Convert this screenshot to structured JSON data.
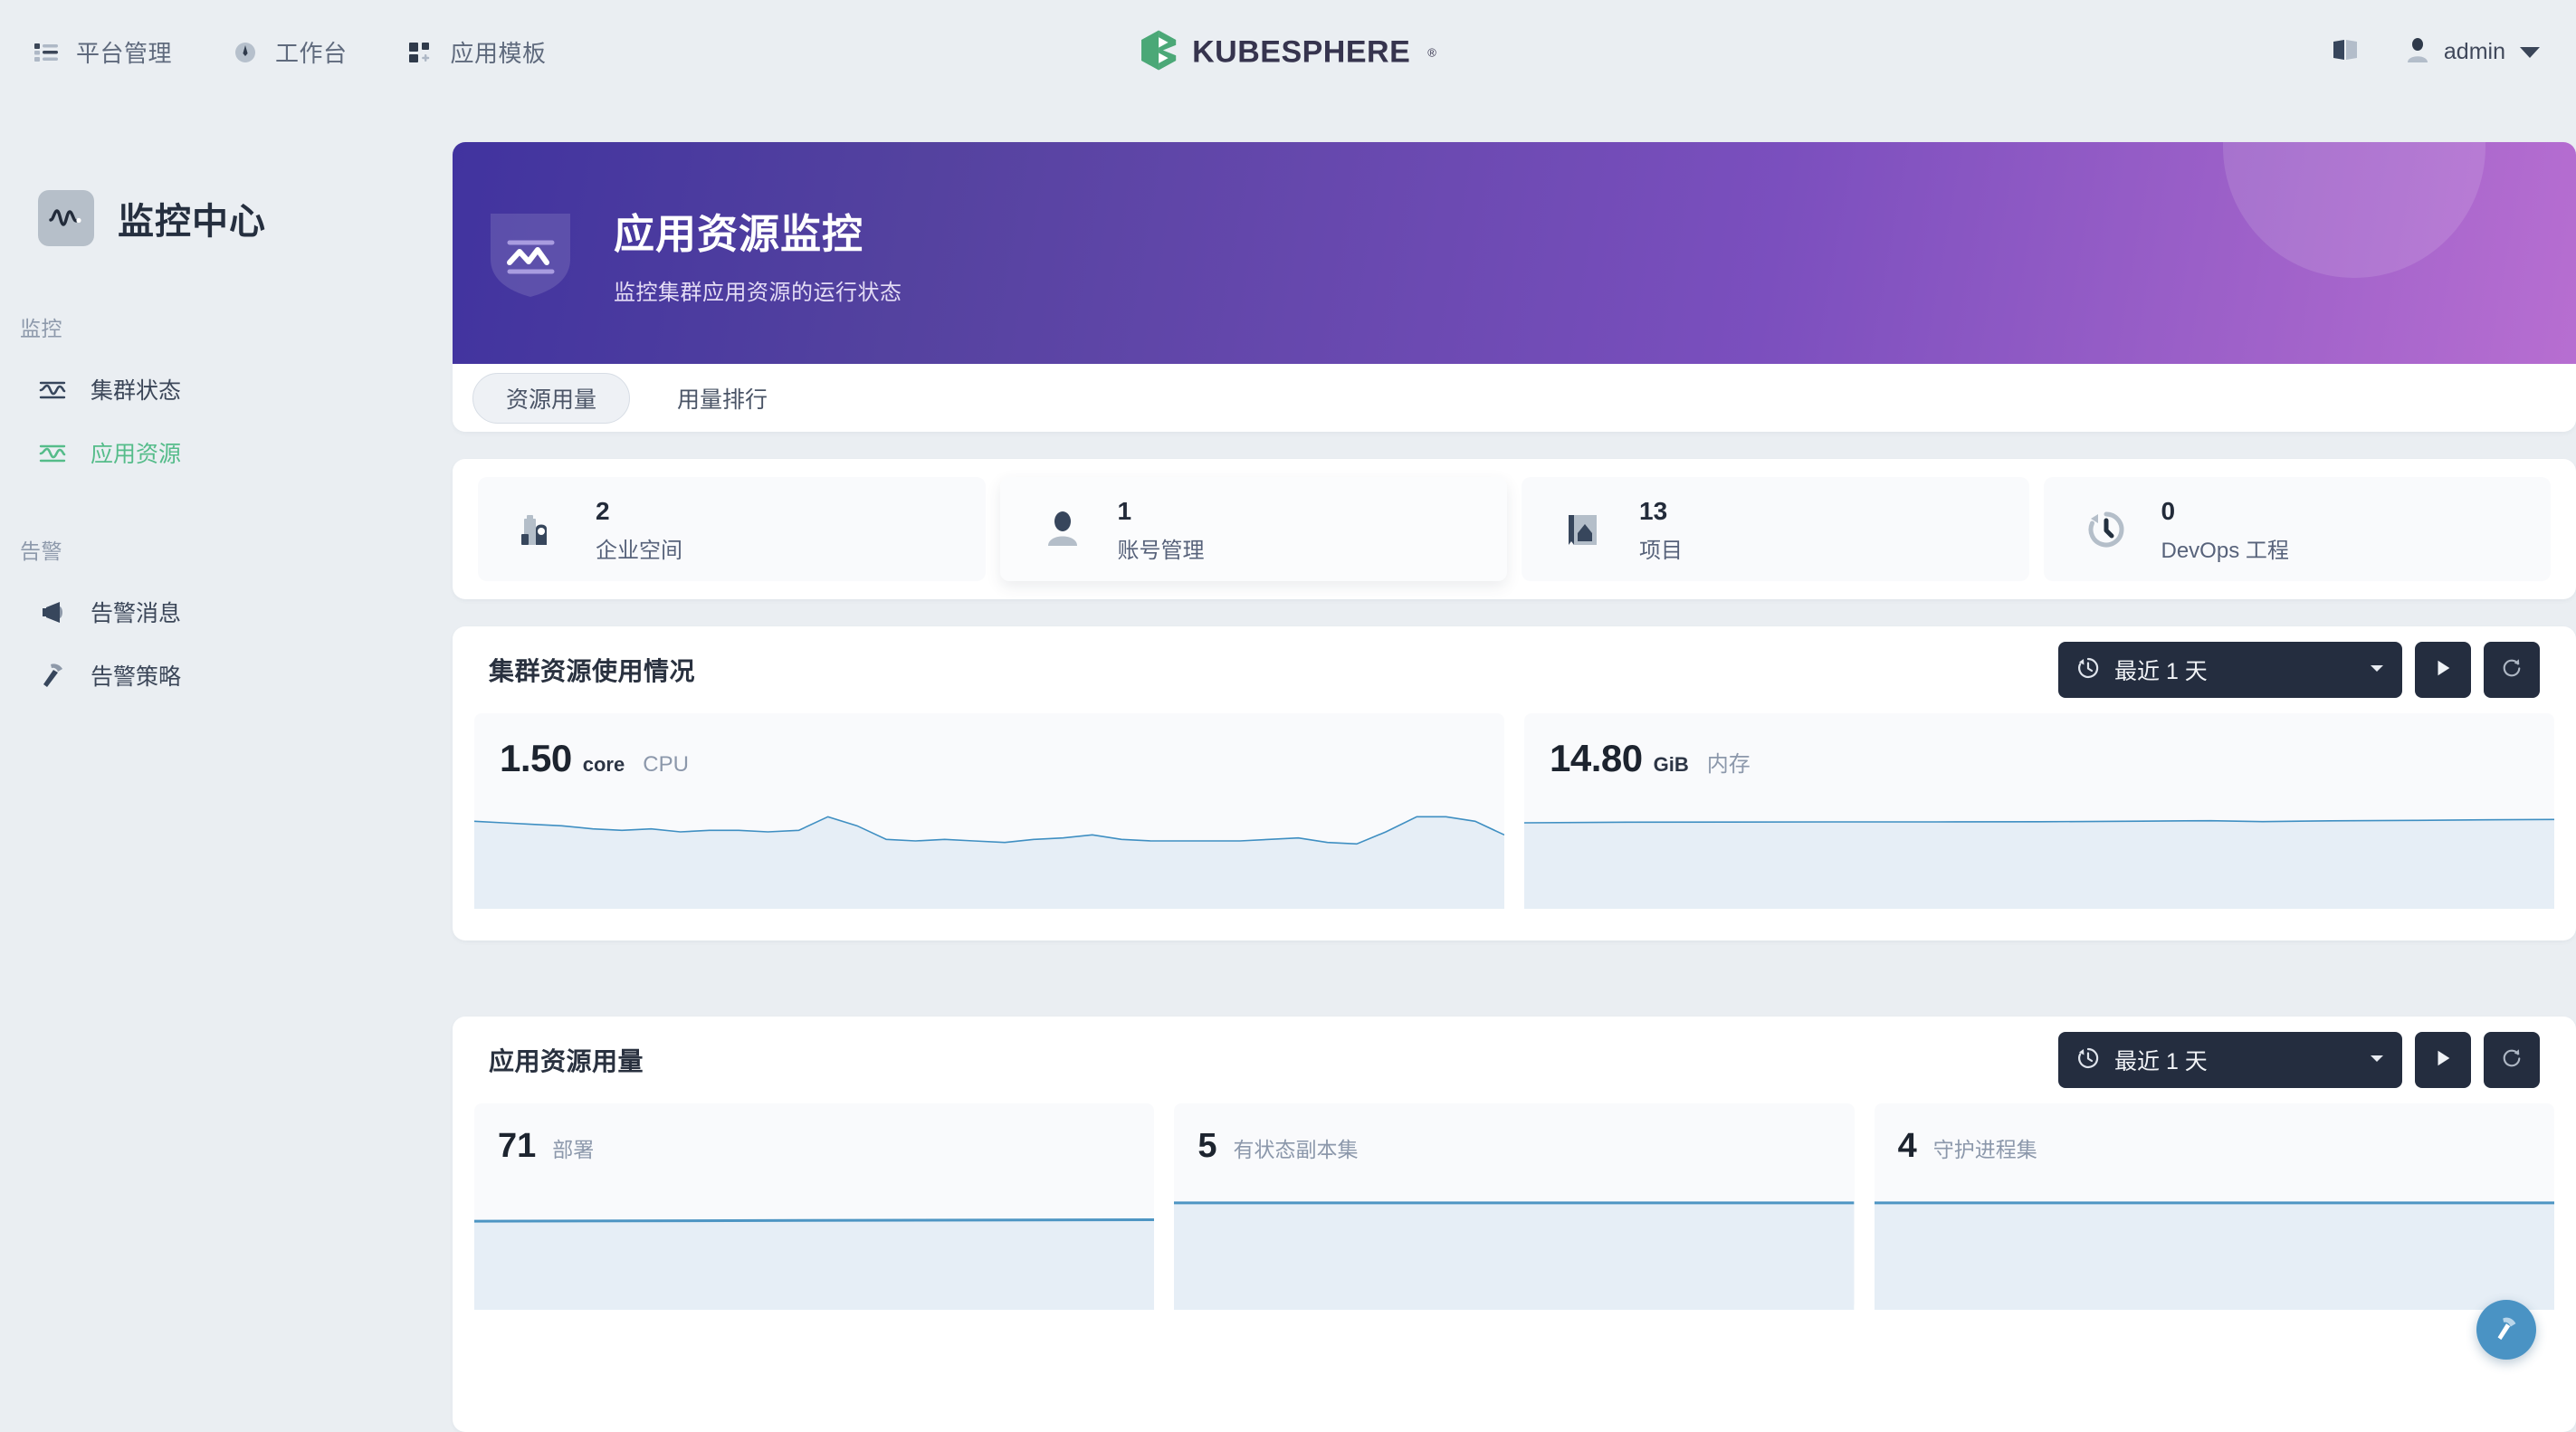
{
  "topnav": {
    "items": [
      {
        "label": "平台管理",
        "icon": "list-layout-icon"
      },
      {
        "label": "工作台",
        "icon": "compass-icon"
      },
      {
        "label": "应用模板",
        "icon": "grid-add-icon"
      }
    ],
    "brand": {
      "word": "KUBESPHERE",
      "reg": "®",
      "logo_color": "#4BA877",
      "word_color": "#36344E"
    },
    "docs_icon": "book-icon",
    "user": {
      "name": "admin",
      "avatar_icon": "user-avatar-icon",
      "caret": "chevron-down-icon"
    }
  },
  "sidebar": {
    "title": "监控中心",
    "title_icon": "monitoring-wave-icon",
    "groups": [
      {
        "label": "监控",
        "items": [
          {
            "label": "集群状态",
            "icon": "wave-icon",
            "active": false
          },
          {
            "label": "应用资源",
            "icon": "wave-icon",
            "active": true
          }
        ]
      },
      {
        "label": "告警",
        "items": [
          {
            "label": "告警消息",
            "icon": "megaphone-icon",
            "active": false
          },
          {
            "label": "告警策略",
            "icon": "hammer-icon",
            "active": false
          }
        ]
      }
    ]
  },
  "banner": {
    "title": "应用资源监控",
    "subtitle": "监控集群应用资源的运行状态",
    "icon": "shield-wave-icon",
    "gradient_from": "#41339F",
    "gradient_to": "#B76ED1"
  },
  "tabs": [
    {
      "label": "资源用量",
      "active": true
    },
    {
      "label": "用量排行",
      "active": false
    }
  ],
  "stat_cards": [
    {
      "value": "2",
      "label": "企业空间",
      "icon": "workspace-icon"
    },
    {
      "value": "1",
      "label": "账号管理",
      "icon": "account-icon"
    },
    {
      "value": "13",
      "label": "项目",
      "icon": "project-icon"
    },
    {
      "value": "0",
      "label": "DevOps 工程",
      "icon": "devops-clock-icon"
    }
  ],
  "cluster_section": {
    "title": "集群资源使用情况",
    "time_range": "最近 1 天",
    "time_icon": "history-clock-icon",
    "caret_icon": "chevron-down-icon",
    "play_button_icon": "play-icon",
    "refresh_button_icon": "refresh-icon"
  },
  "app_section": {
    "title": "应用资源用量",
    "time_range": "最近 1 天",
    "time_icon": "history-clock-icon",
    "caret_icon": "chevron-down-icon",
    "play_button_icon": "play-icon",
    "refresh_button_icon": "refresh-icon"
  },
  "fab": {
    "icon": "hammer-icon",
    "color": "#4A93C4"
  },
  "chart_data": [
    {
      "type": "area",
      "title": "CPU",
      "value": "1.50",
      "unit": "core",
      "ylabel": "core",
      "xlabel": "最近 1 天",
      "grid": false,
      "legend": "none",
      "line_color": "#3f8fc2",
      "fill_color": "#e6eef6",
      "ylim": [
        0,
        2.0
      ],
      "x": [
        0,
        1,
        2,
        3,
        4,
        5,
        6,
        7,
        8,
        9,
        10,
        11,
        12,
        13,
        14,
        15,
        16,
        17,
        18,
        19,
        20,
        21,
        22,
        23,
        24,
        25,
        26,
        27,
        28,
        29,
        30,
        31,
        32,
        33,
        34,
        35
      ],
      "values": [
        1.5,
        1.49,
        1.48,
        1.47,
        1.45,
        1.44,
        1.45,
        1.43,
        1.44,
        1.44,
        1.43,
        1.44,
        1.52,
        1.46,
        1.38,
        1.37,
        1.38,
        1.37,
        1.36,
        1.38,
        1.39,
        1.41,
        1.38,
        1.37,
        1.37,
        1.37,
        1.37,
        1.38,
        1.39,
        1.36,
        1.35,
        1.42,
        1.52,
        1.52,
        1.49,
        1.41
      ]
    },
    {
      "type": "area",
      "title": "内存",
      "value": "14.80",
      "unit": "GiB",
      "ylabel": "GiB",
      "xlabel": "最近 1 天",
      "grid": false,
      "legend": "none",
      "line_color": "#3f8fc2",
      "fill_color": "#e6eef6",
      "ylim": [
        0,
        16.0
      ],
      "x": [
        0,
        1,
        2,
        3,
        4,
        5,
        6,
        7,
        8,
        9,
        10,
        11,
        12,
        13,
        14,
        15,
        16,
        17,
        18,
        19,
        20,
        21,
        22,
        23,
        24,
        25,
        26,
        27,
        28,
        29,
        30,
        31,
        32,
        33,
        34,
        35
      ],
      "values": [
        14.78,
        14.79,
        14.79,
        14.8,
        14.8,
        14.8,
        14.8,
        14.8,
        14.81,
        14.8,
        14.8,
        14.8,
        14.8,
        14.8,
        14.8,
        14.8,
        14.8,
        14.8,
        14.8,
        14.81,
        14.82,
        14.83,
        14.82,
        14.8,
        14.79,
        14.79,
        14.8,
        14.81,
        14.82,
        14.83,
        14.83,
        14.83,
        14.83,
        14.84,
        14.84,
        14.84
      ]
    },
    {
      "type": "area",
      "title": "部署",
      "value": "71",
      "unit": "",
      "grid": false,
      "legend": "none",
      "line_color": "#4d95c3",
      "fill_color": "#e6eef6",
      "ylim": [
        0,
        100
      ],
      "x": [
        0,
        1,
        2,
        3,
        4,
        5,
        6,
        7,
        8,
        9,
        10
      ],
      "values": [
        71,
        71,
        71,
        71,
        71,
        71,
        71,
        71,
        71,
        71,
        71
      ]
    },
    {
      "type": "area",
      "title": "有状态副本集",
      "value": "5",
      "unit": "",
      "grid": false,
      "legend": "none",
      "line_color": "#3f8fc2",
      "fill_color": "#e6eef6",
      "ylim": [
        0,
        6
      ],
      "x": [
        0,
        1,
        2,
        3,
        4,
        5,
        6,
        7,
        8,
        9,
        10
      ],
      "values": [
        5,
        5,
        5,
        5,
        5,
        5,
        5,
        5,
        5,
        5,
        5
      ]
    },
    {
      "type": "area",
      "title": "守护进程集",
      "value": "4",
      "unit": "",
      "grid": false,
      "legend": "none",
      "line_color": "#3f8fc2",
      "fill_color": "#e6eef6",
      "ylim": [
        0,
        5
      ],
      "x": [
        0,
        1,
        2,
        3,
        4,
        5,
        6,
        7,
        8,
        9,
        10
      ],
      "values": [
        4,
        4,
        4,
        4,
        4,
        4,
        4,
        4,
        4,
        4,
        4
      ]
    }
  ]
}
